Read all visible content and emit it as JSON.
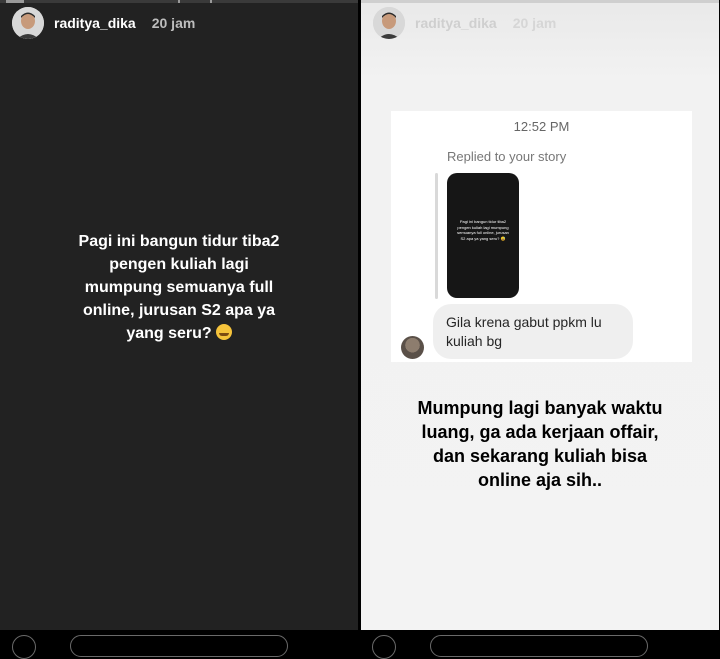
{
  "left_story": {
    "username": "raditya_dika",
    "time": "20 jam",
    "text_lines": [
      "Pagi ini bangun tidur tiba2",
      "pengen kuliah lagi",
      "mumpung semuanya full",
      "online, jurusan S2 apa ya",
      "yang seru?"
    ],
    "emoji": "grinning-sweat-emoji"
  },
  "right_story": {
    "username": "raditya_dika",
    "time": "20 jam",
    "message_card": {
      "timestamp": "12:52 PM",
      "replied_label": "Replied to your story",
      "thumb_text": "Pagi ini bangun tidur tiba2 pengen kuliah lagi mumpung semuanya full online, jurusan S2 apa ya yang seru? 😅",
      "message_line1": "Gila krena gabut ppkm lu",
      "message_line2": "kuliah bg"
    },
    "text_lines": [
      "Mumpung lagi banyak waktu",
      "luang, ga ada kerjaan offair,",
      "dan sekarang kuliah bisa",
      "online aja sih.."
    ]
  },
  "colors": {
    "left_bg": "#222222",
    "right_bg": "#f3f3f3"
  }
}
